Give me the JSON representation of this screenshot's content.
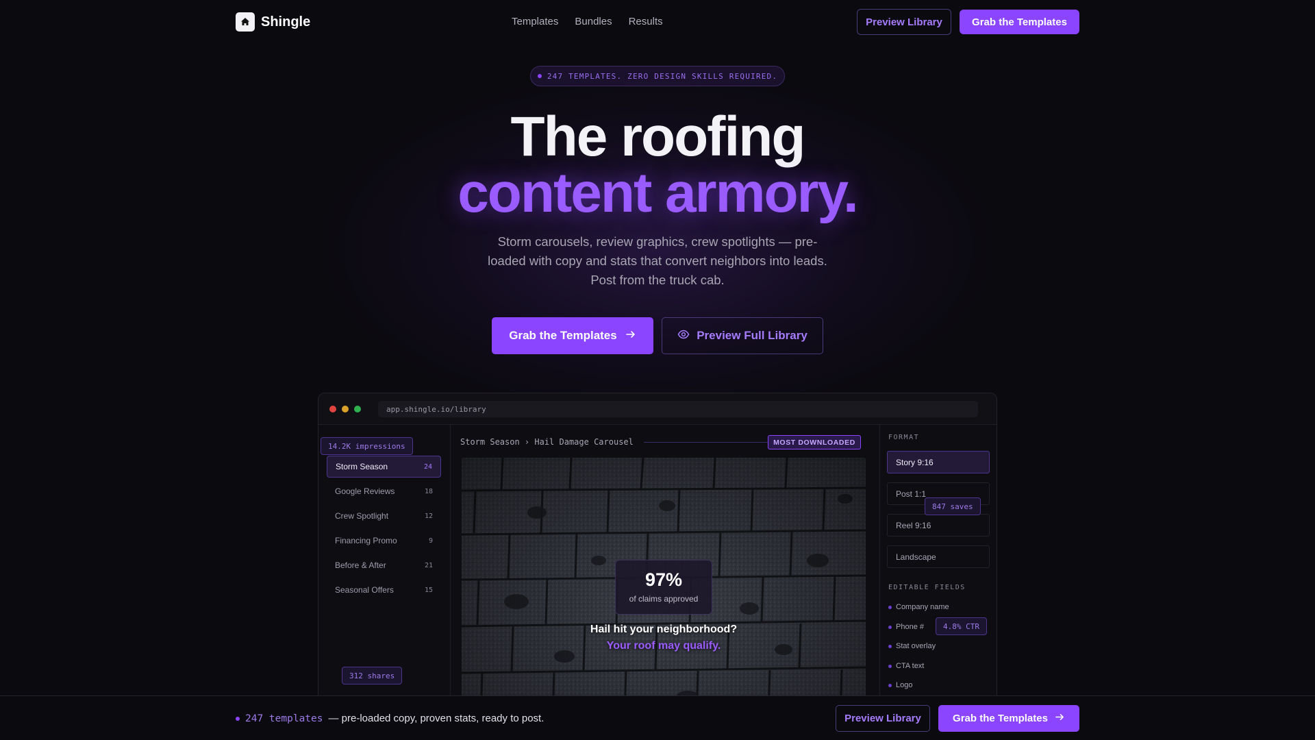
{
  "brand": {
    "name": "Shingle",
    "logo_icon": "house-icon"
  },
  "nav": {
    "links": [
      "Templates",
      "Bundles",
      "Results"
    ],
    "preview_label": "Preview Library",
    "grab_label": "Grab the Templates"
  },
  "hero": {
    "pill": "247 TEMPLATES. ZERO DESIGN SKILLS REQUIRED.",
    "title_line1": "The roofing",
    "title_line2": "content armory.",
    "subtitle": "Storm carousels, review graphics, crew spotlights — pre-loaded with copy and stats that convert neighbors into leads. Post from the truck cab.",
    "cta_primary": "Grab the Templates",
    "cta_secondary": "Preview Full Library"
  },
  "app": {
    "url": "app.shingle.io/library",
    "sidebar": [
      {
        "label": "Storm Season",
        "count": "24",
        "active": true
      },
      {
        "label": "Google Reviews",
        "count": "18"
      },
      {
        "label": "Crew Spotlight",
        "count": "12"
      },
      {
        "label": "Financing Promo",
        "count": "9"
      },
      {
        "label": "Before & After",
        "count": "21"
      },
      {
        "label": "Seasonal Offers",
        "count": "15"
      }
    ],
    "floating_tags": {
      "impressions": "14.2K impressions",
      "shares": "312 shares",
      "saves": "847 saves",
      "ctr": "4.8% CTR"
    },
    "breadcrumb": "Storm Season › Hail Damage Carousel",
    "badge": "MOST DOWNLOADED",
    "preview": {
      "stat_value": "97%",
      "stat_label": "of claims approved",
      "headline": "Hail hit your neighborhood?",
      "subheadline": "Your roof may qualify."
    },
    "format_label": "FORMAT",
    "formats": [
      "Story 9:16",
      "Post 1:1",
      "Reel 9:16",
      "Landscape"
    ],
    "active_format": "Story 9:16",
    "fields_label": "EDITABLE FIELDS",
    "fields": [
      "Company name",
      "Phone #",
      "Stat overlay",
      "CTA text",
      "Logo"
    ]
  },
  "bottom_bar": {
    "count": "247 templates",
    "text": "— pre-loaded copy, proven stats, ready to post.",
    "preview_label": "Preview Library",
    "grab_label": "Grab the Templates"
  },
  "colors": {
    "accent": "#8b45ff",
    "background": "#0b0a0f",
    "accent_text": "#a67cff"
  }
}
